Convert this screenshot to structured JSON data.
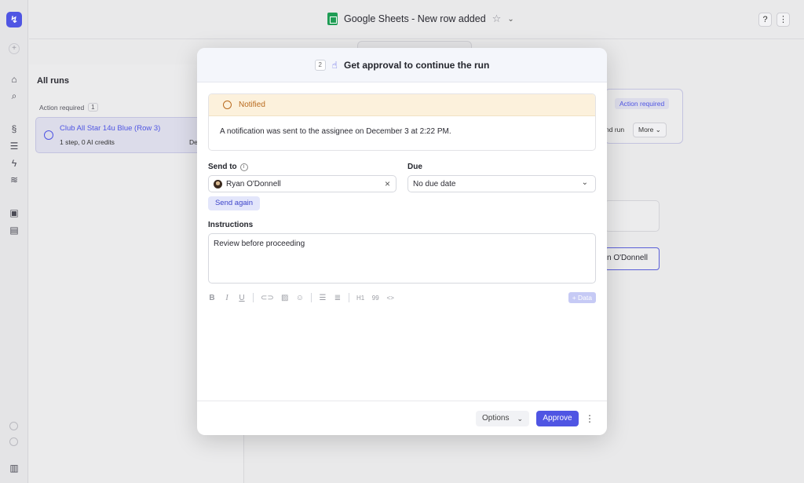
{
  "app": {
    "header": {
      "title": "Google Sheets - New row added",
      "help_label": "?",
      "star_icon": "star-icon",
      "menu_icon": "kebab-icon"
    },
    "left_panel": {
      "title": "All runs",
      "section_label": "Action required",
      "section_count": "1",
      "run": {
        "title": "Club All Star 14u Blue (Row 3)",
        "subtitle": "1 step, 0 AI credits",
        "date_fragment": "De"
      }
    },
    "right_panel": {
      "badge": "Action required",
      "end_run_fragment": "nd run",
      "more_label": "More",
      "assignee_fragment": "n O'Donnell"
    }
  },
  "modal": {
    "step_number": "2",
    "title": "Get approval to continue the run",
    "notice": {
      "label": "Notified",
      "message": "A notification was sent to the assignee on December 3 at 2:22 PM."
    },
    "send_to": {
      "label": "Send to",
      "value": "Ryan O'Donnell"
    },
    "due": {
      "label": "Due",
      "value": "No due date"
    },
    "send_again_label": "Send again",
    "instructions": {
      "label": "Instructions",
      "value": "Review before proceeding"
    },
    "toolbar": {
      "bold": "B",
      "italic": "I",
      "underline": "U",
      "heading": "H1",
      "quote": "99",
      "code": "<>",
      "data_label": "+ Data"
    },
    "footer": {
      "options_label": "Options",
      "approve_label": "Approve"
    }
  },
  "colors": {
    "accent": "#4f55e3",
    "notice_bg": "#fcf1dc",
    "notice_text": "#b86a1e"
  }
}
